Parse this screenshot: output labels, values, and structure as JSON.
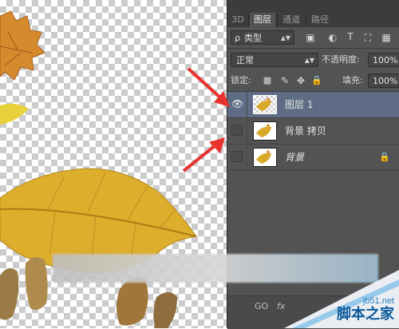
{
  "tabs": [
    {
      "label": "3D"
    },
    {
      "label": "图层"
    },
    {
      "label": "通道"
    },
    {
      "label": "路径"
    }
  ],
  "filter": {
    "kind": "类型",
    "search_glyph": "ρ"
  },
  "blend_mode": "正常",
  "opacity": {
    "label": "不透明度:",
    "value": "100%"
  },
  "lock": {
    "label": "锁定:"
  },
  "fill": {
    "label": "填充:",
    "value": "100%"
  },
  "layers": [
    {
      "name": "图层 1",
      "visible": true,
      "selected": true
    },
    {
      "name": "背景 拷贝",
      "visible": false,
      "selected": false
    },
    {
      "name": "背景",
      "visible": false,
      "selected": false,
      "locked": true
    }
  ],
  "footer": {
    "link": "GO",
    "fx": "fx"
  },
  "watermark": {
    "site": "jb51.net",
    "name": "脚本之家"
  },
  "colors": {
    "panel": "#535353",
    "selected_layer": "#5e6d85",
    "arrow": "#e8322e",
    "leaf": "#d9a92a"
  }
}
